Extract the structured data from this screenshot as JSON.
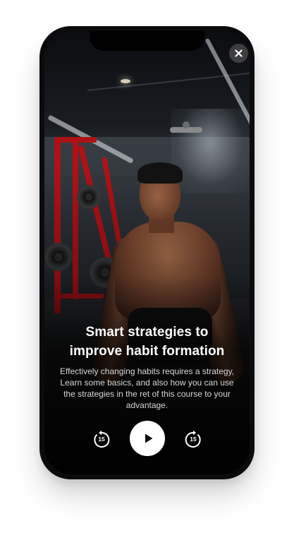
{
  "lesson": {
    "title_line1": "Smart strategies to",
    "title_line2": "improve habit formation",
    "description": "Effectively changing habits requires a strategy, Learn some basics, and also how you can use the strategies in the ret of this course to your advantage."
  },
  "player": {
    "skip_back_seconds": "15",
    "skip_forward_seconds": "15",
    "play_icon": "play-icon",
    "skip_back_icon": "rewind-15-icon",
    "skip_forward_icon": "forward-15-icon"
  },
  "close": {
    "icon": "close-icon"
  },
  "colors": {
    "rack_red": "#b01217",
    "text_primary": "#ffffff",
    "text_secondary": "#d7d7d7"
  }
}
